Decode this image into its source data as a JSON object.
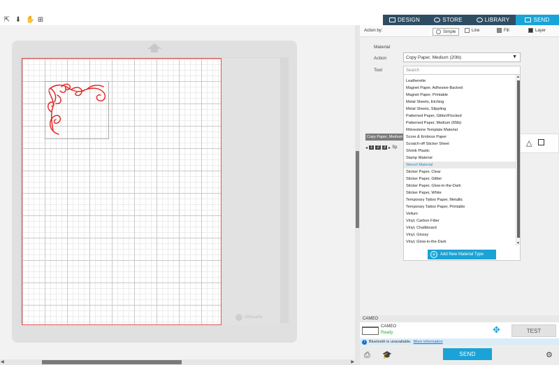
{
  "tabs": [
    {
      "label": "DESIGN",
      "icon": "design-icon"
    },
    {
      "label": "STORE",
      "icon": "store-icon"
    },
    {
      "label": "LIBRARY",
      "icon": "library-icon"
    },
    {
      "label": "SEND",
      "icon": "send-icon",
      "active": true
    }
  ],
  "toolbar": {
    "icons": [
      "pointer-move-icon",
      "down-arrow-icon",
      "hand-pan-icon",
      "add-page-icon"
    ]
  },
  "mat": {
    "logo_text": "silhouette",
    "design_color": "#e02020"
  },
  "panel": {
    "action_by_label": "Action by:",
    "modes": {
      "simple": "Simple",
      "line": "Line",
      "fill": "Fill",
      "layer": "Layer"
    },
    "material_label": "Material",
    "action_label": "Action",
    "tool_label": "Tool",
    "material_value": "Copy Paper, Medium (20lb)",
    "search_placeholder": "Search",
    "materials": [
      "Leatherette",
      "Magnet Paper, Adhesive-Backed",
      "Magnet Paper, Printable",
      "Metal Sheets, Etching",
      "Metal Sheets, Stippling",
      "Patterned Paper, Glitter/Flocked",
      "Patterned Paper, Medium (65lb)",
      "Rhinestone Template Material",
      "Score & Emboss Paper",
      "Scratch-off Sticker Sheet",
      "Shrink Plastic",
      "Stamp Material",
      "Stencil Material",
      "Sticker Paper, Clear",
      "Sticker Paper, Glitter",
      "Sticker Paper, Glow-in-the-Dark",
      "Sticker Paper, White",
      "Temporary Tattoo Paper, Metallic",
      "Temporary Tattoo Paper, Printable",
      "Vellum",
      "Vinyl, Carbon Fiber",
      "Vinyl, Chalkboard",
      "Vinyl, Glossy",
      "Vinyl, Glow-in-the-Dark"
    ],
    "selected_material": "Stencil Material",
    "add_material_label": "Add New Material Type",
    "peek_label": "Copy Paper, Medium",
    "peek_nums": [
      "1",
      "2",
      "3"
    ],
    "peek_sp": "Sp"
  },
  "device": {
    "section_label": "CAMEO",
    "name": "CAMEO",
    "status": "Ready",
    "status_color": "#2eaa2e",
    "test_label": "TEST",
    "bluetooth_text": "Bluetooth is unavailable.",
    "bluetooth_link": "More information",
    "send_label": "SEND"
  },
  "colors": {
    "accent": "#1aa3d6",
    "nav_dark": "#2e4d63"
  }
}
